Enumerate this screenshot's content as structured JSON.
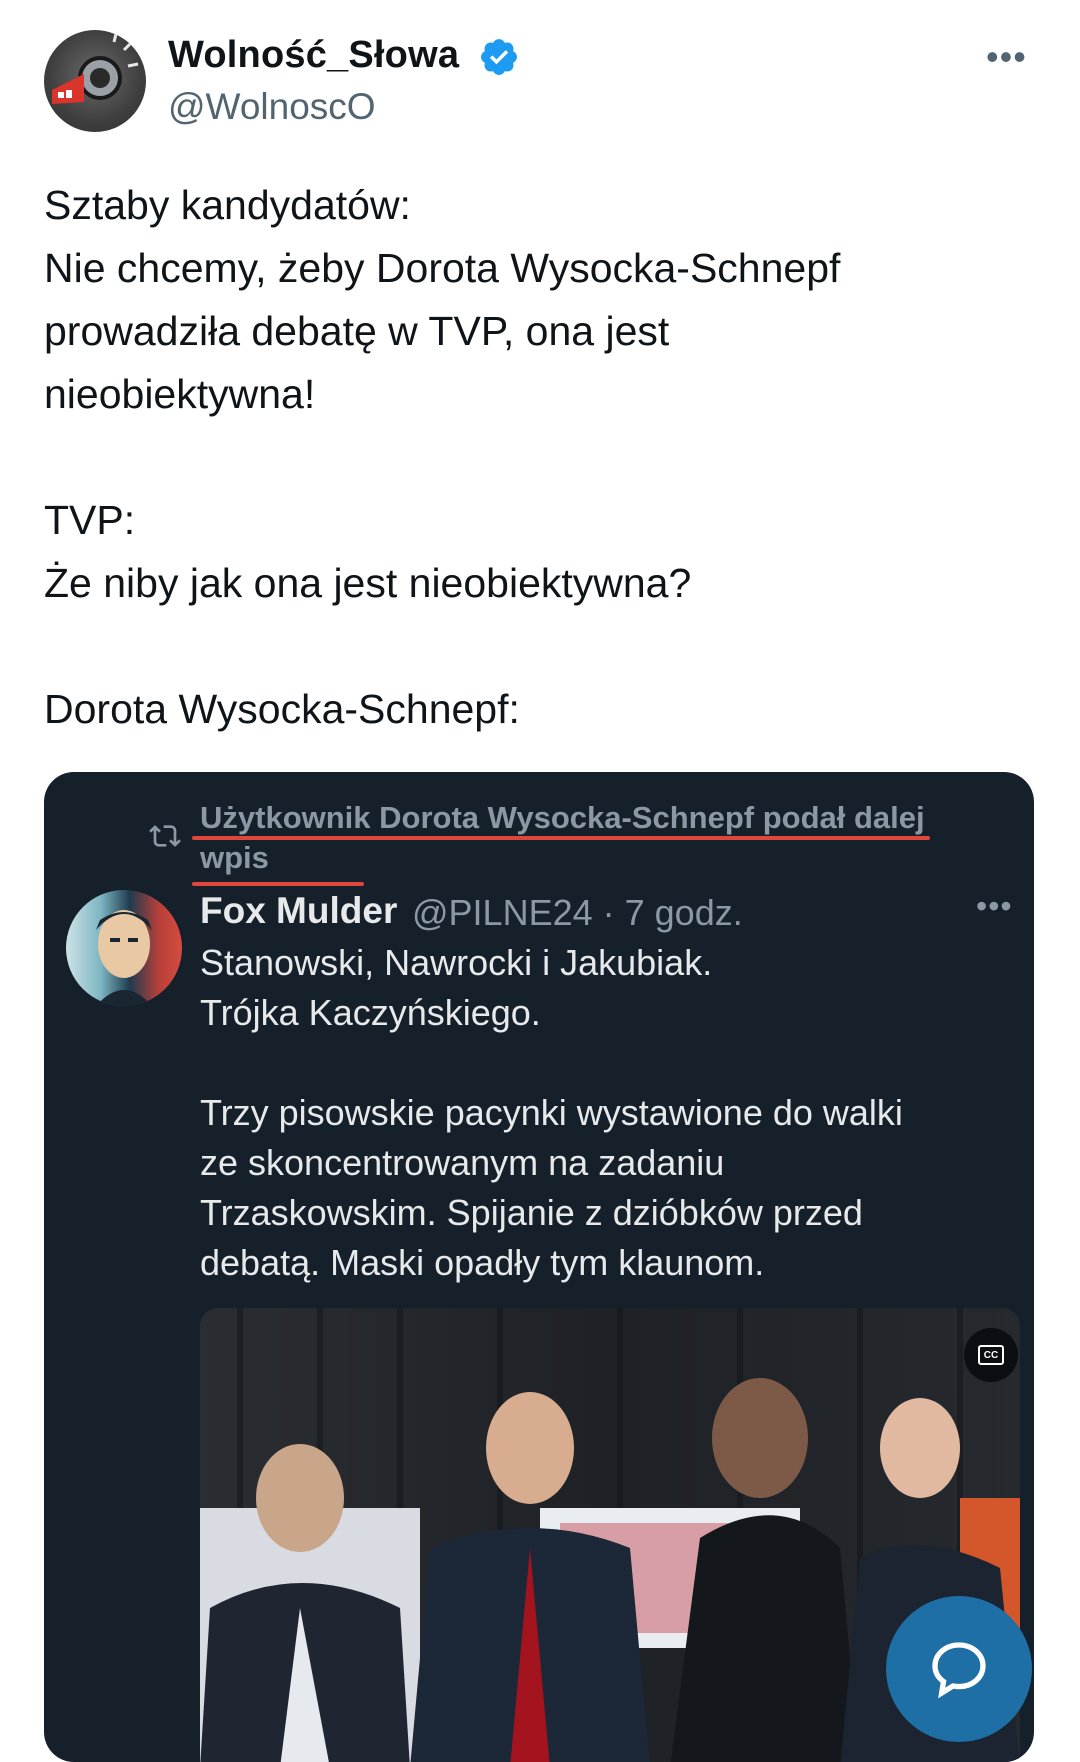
{
  "tweet": {
    "author": {
      "display_name": "Wolność_Słowa",
      "handle": "@WolnoscO",
      "verified_icon": "verified-badge-icon",
      "avatar_icon": "megaphone-icon"
    },
    "more_icon": "more-horizontal-icon",
    "body": {
      "para1": [
        "Sztaby kandydatów:",
        "Nie chcemy, żeby Dorota Wysocka-Schnepf",
        "prowadziła debatę w TVP, ona jest",
        "nieobiektywna!"
      ],
      "para2": [
        "TVP:",
        "Że niby jak ona jest nieobiektywna?"
      ],
      "para3": [
        "Dorota Wysocka-Schnepf:"
      ]
    }
  },
  "embedded_screenshot": {
    "repost_icon": "repost-icon",
    "repost_text": "Użytkownik Dorota Wysocka-Schnepf podał dalej wpis",
    "quoted": {
      "display_name": "Fox Mulder",
      "handle_time": "@PILNE24 · 7 godz.",
      "lines_1": [
        "Stanowski, Nawrocki i Jakubiak.",
        "Trójka Kaczyńskiego."
      ],
      "lines_2": [
        "Trzy pisowskie pacynki wystawione do walki",
        "ze skoncentrowanym na zadaniu",
        "Trzaskowskim. Spijanie z dzióbków przed",
        "debatą. Maski opadły tym klaunom."
      ]
    },
    "video": {
      "cc_icon": "closed-captions-icon",
      "mute_icon": "muted-speaker-icon"
    }
  },
  "fab": {
    "icon": "chat-bubble-icon"
  },
  "colors": {
    "verified": "#1d9bf0",
    "embed_bg": "#16202b",
    "underline": "#e0463b",
    "fab": "#1d6fa5"
  }
}
